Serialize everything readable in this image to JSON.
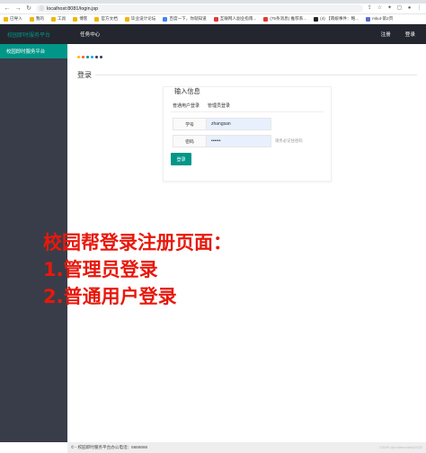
{
  "browser": {
    "url": "localhost:8081/login.jsp",
    "bookmarks": [
      {
        "label": "已导入",
        "color": "#f4b400"
      },
      {
        "label": "我的",
        "color": "#f4b400"
      },
      {
        "label": "工具",
        "color": "#f4b400"
      },
      {
        "label": "博客",
        "color": "#f4b400"
      },
      {
        "label": "官方文档",
        "color": "#f4b400"
      },
      {
        "label": "毕业设计论坛",
        "color": "#f4b400"
      },
      {
        "label": "百度一下，你就知道",
        "color": "#4285f4"
      },
      {
        "label": "互联网人副业指南...",
        "color": "#e53935"
      },
      {
        "label": "(75条消息) 推荐系...",
        "color": "#e53935"
      },
      {
        "label": "(4) 【萌娘事件：略...",
        "color": "#222222"
      },
      {
        "label": "mkut-第2页",
        "color": "#5a6bd6"
      }
    ]
  },
  "nav": {
    "brand": "校园即时服务平台",
    "item": "任务中心",
    "right": [
      "注册",
      "登录"
    ]
  },
  "sidebar": {
    "item": "校园即时服务平台"
  },
  "main": {
    "dots": [
      "#ffb800",
      "#ff5722",
      "#009688",
      "#1e9fff",
      "#393d49",
      "#2f4056"
    ],
    "section_title": "登录",
    "card": {
      "title": "输入信息",
      "tabs": [
        "普通用户登录",
        "管理员登录"
      ],
      "student_id_label": "学号",
      "student_id_value": "zhangsan",
      "password_label": "密码",
      "password_value": "••••••",
      "password_hint": "请务必记住密码",
      "login_button": "登录"
    },
    "overlay_lines": [
      "校园帮登录注册页面：",
      "1.管理员登录",
      "2.普通用户登录"
    ]
  },
  "footer": {
    "text": "© - 校园即时服务平台办公电话：6666666",
    "watermark": "CSDN @codemonkey2022"
  }
}
